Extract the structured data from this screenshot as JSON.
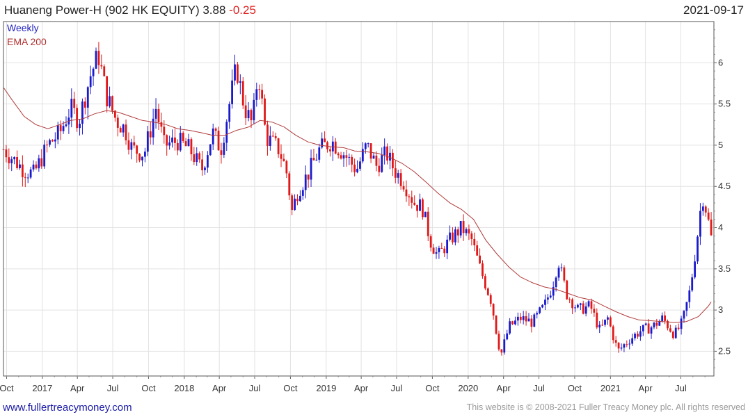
{
  "header": {
    "title": "Huaneng Power-H (902 HK EQUITY) 3.88",
    "change": "-0.25",
    "date": "2021-09-17"
  },
  "legend": {
    "weekly": "Weekly",
    "ema": "EMA 200"
  },
  "footer": {
    "site": "www.fullertreacymoney.com",
    "copyright": "This website is © 2008-2021 Fuller Treacy Money plc. All rights reserved"
  },
  "colors": {
    "up": "#1a1acc",
    "down": "#e01818",
    "ema": "#b03a3a",
    "grid": "#e2e2e2",
    "border": "#555555"
  },
  "chart_data": {
    "type": "candlestick",
    "frequency": "Weekly",
    "ylim": [
      2.2,
      6.5
    ],
    "yticks": [
      2.5,
      3,
      3.5,
      4,
      4.5,
      5,
      5.5,
      6
    ],
    "ytick_labels": [
      "2.5",
      "3",
      "3.5",
      "4",
      "4.5",
      "5",
      "5.5",
      "6"
    ],
    "xlim": [
      "2016-09-23",
      "2021-09-24"
    ],
    "xticks": [
      {
        "date": "2016-10-01",
        "label": "Oct"
      },
      {
        "date": "2017-01-01",
        "label": "2017"
      },
      {
        "date": "2017-04-01",
        "label": "Apr"
      },
      {
        "date": "2017-07-01",
        "label": "Jul"
      },
      {
        "date": "2017-10-01",
        "label": "Oct"
      },
      {
        "date": "2018-01-01",
        "label": "2018"
      },
      {
        "date": "2018-04-01",
        "label": "Apr"
      },
      {
        "date": "2018-07-01",
        "label": "Jul"
      },
      {
        "date": "2018-10-01",
        "label": "Oct"
      },
      {
        "date": "2019-01-01",
        "label": "2019"
      },
      {
        "date": "2019-04-01",
        "label": "Apr"
      },
      {
        "date": "2019-07-01",
        "label": "Jul"
      },
      {
        "date": "2019-10-01",
        "label": "Oct"
      },
      {
        "date": "2020-01-01",
        "label": "2020"
      },
      {
        "date": "2020-04-01",
        "label": "Apr"
      },
      {
        "date": "2020-07-01",
        "label": "Jul"
      },
      {
        "date": "2020-10-01",
        "label": "Oct"
      },
      {
        "date": "2021-01-01",
        "label": "2021"
      },
      {
        "date": "2021-04-01",
        "label": "Apr"
      },
      {
        "date": "2021-07-01",
        "label": "Jul"
      }
    ],
    "close_path": [
      [
        "2016-09-23",
        4.95
      ],
      [
        "2016-11-15",
        4.7
      ],
      [
        "2016-12-10",
        4.65
      ],
      [
        "2017-01-15",
        5.0
      ],
      [
        "2017-02-15",
        5.15
      ],
      [
        "2017-03-15",
        5.45
      ],
      [
        "2017-04-05",
        5.3
      ],
      [
        "2017-05-05",
        5.85
      ],
      [
        "2017-05-25",
        6.1
      ],
      [
        "2017-06-15",
        5.6
      ],
      [
        "2017-07-10",
        5.3
      ],
      [
        "2017-08-01",
        5.2
      ],
      [
        "2017-08-20",
        4.95
      ],
      [
        "2017-09-20",
        4.9
      ],
      [
        "2017-10-20",
        5.45
      ],
      [
        "2017-11-10",
        5.0
      ],
      [
        "2017-12-15",
        5.05
      ],
      [
        "2018-01-15",
        4.95
      ],
      [
        "2018-02-15",
        4.7
      ],
      [
        "2018-03-15",
        5.15
      ],
      [
        "2018-04-05",
        4.95
      ],
      [
        "2018-05-01",
        5.6
      ],
      [
        "2018-05-15",
        5.95
      ],
      [
        "2018-06-05",
        5.45
      ],
      [
        "2018-06-25",
        5.25
      ],
      [
        "2018-07-10",
        5.9
      ],
      [
        "2018-07-30",
        5.1
      ],
      [
        "2018-09-01",
        4.95
      ],
      [
        "2018-09-20",
        4.7
      ],
      [
        "2018-10-05",
        4.2
      ],
      [
        "2018-10-20",
        4.45
      ],
      [
        "2018-11-15",
        4.65
      ],
      [
        "2018-12-15",
        4.95
      ],
      [
        "2019-01-15",
        5.05
      ],
      [
        "2019-02-15",
        4.9
      ],
      [
        "2019-03-20",
        4.7
      ],
      [
        "2019-04-15",
        5.0
      ],
      [
        "2019-05-10",
        4.75
      ],
      [
        "2019-06-05",
        4.9
      ],
      [
        "2019-06-25",
        4.7
      ],
      [
        "2019-07-20",
        4.55
      ],
      [
        "2019-08-15",
        4.3
      ],
      [
        "2019-09-05",
        4.25
      ],
      [
        "2019-09-25",
        3.85
      ],
      [
        "2019-10-15",
        3.65
      ],
      [
        "2019-11-15",
        3.85
      ],
      [
        "2019-12-15",
        4.0
      ],
      [
        "2020-01-10",
        3.85
      ],
      [
        "2020-02-01",
        3.5
      ],
      [
        "2020-03-01",
        3.1
      ],
      [
        "2020-03-15",
        2.7
      ],
      [
        "2020-03-25",
        2.45
      ],
      [
        "2020-04-15",
        2.8
      ],
      [
        "2020-05-15",
        2.9
      ],
      [
        "2020-06-15",
        2.85
      ],
      [
        "2020-07-15",
        3.05
      ],
      [
        "2020-08-05",
        3.3
      ],
      [
        "2020-08-20",
        3.6
      ],
      [
        "2020-09-10",
        3.2
      ],
      [
        "2020-10-10",
        3.0
      ],
      [
        "2020-11-10",
        3.05
      ],
      [
        "2020-12-05",
        2.75
      ],
      [
        "2020-12-25",
        2.9
      ],
      [
        "2021-01-20",
        2.5
      ],
      [
        "2021-02-20",
        2.65
      ],
      [
        "2021-03-20",
        2.75
      ],
      [
        "2021-04-20",
        2.8
      ],
      [
        "2021-05-15",
        2.9
      ],
      [
        "2021-06-15",
        2.7
      ],
      [
        "2021-07-05",
        2.85
      ],
      [
        "2021-07-25",
        3.25
      ],
      [
        "2021-08-10",
        3.8
      ],
      [
        "2021-08-25",
        4.4
      ],
      [
        "2021-09-05",
        4.2
      ],
      [
        "2021-09-17",
        3.88
      ]
    ],
    "ema200": [
      [
        "2016-09-23",
        5.7
      ],
      [
        "2016-10-15",
        5.55
      ],
      [
        "2016-11-15",
        5.35
      ],
      [
        "2016-12-15",
        5.25
      ],
      [
        "2017-01-15",
        5.2
      ],
      [
        "2017-02-15",
        5.25
      ],
      [
        "2017-03-15",
        5.3
      ],
      [
        "2017-04-15",
        5.32
      ],
      [
        "2017-05-15",
        5.38
      ],
      [
        "2017-06-15",
        5.42
      ],
      [
        "2017-07-15",
        5.4
      ],
      [
        "2017-08-15",
        5.35
      ],
      [
        "2017-09-15",
        5.3
      ],
      [
        "2017-10-15",
        5.28
      ],
      [
        "2017-11-15",
        5.25
      ],
      [
        "2017-12-15",
        5.2
      ],
      [
        "2018-01-15",
        5.18
      ],
      [
        "2018-02-15",
        5.15
      ],
      [
        "2018-03-15",
        5.12
      ],
      [
        "2018-04-15",
        5.12
      ],
      [
        "2018-05-15",
        5.18
      ],
      [
        "2018-06-15",
        5.22
      ],
      [
        "2018-07-15",
        5.3
      ],
      [
        "2018-08-15",
        5.28
      ],
      [
        "2018-09-15",
        5.22
      ],
      [
        "2018-10-15",
        5.12
      ],
      [
        "2018-11-15",
        5.04
      ],
      [
        "2018-12-15",
        5.0
      ],
      [
        "2019-01-15",
        4.98
      ],
      [
        "2019-02-15",
        4.97
      ],
      [
        "2019-03-15",
        4.93
      ],
      [
        "2019-04-15",
        4.92
      ],
      [
        "2019-05-15",
        4.9
      ],
      [
        "2019-06-15",
        4.85
      ],
      [
        "2019-07-15",
        4.78
      ],
      [
        "2019-08-15",
        4.68
      ],
      [
        "2019-09-15",
        4.55
      ],
      [
        "2019-10-15",
        4.42
      ],
      [
        "2019-11-15",
        4.3
      ],
      [
        "2019-12-15",
        4.22
      ],
      [
        "2020-01-15",
        4.1
      ],
      [
        "2020-02-15",
        3.85
      ],
      [
        "2020-03-15",
        3.68
      ],
      [
        "2020-04-15",
        3.52
      ],
      [
        "2020-05-15",
        3.4
      ],
      [
        "2020-06-15",
        3.33
      ],
      [
        "2020-07-15",
        3.28
      ],
      [
        "2020-08-15",
        3.25
      ],
      [
        "2020-09-15",
        3.2
      ],
      [
        "2020-10-15",
        3.15
      ],
      [
        "2020-11-15",
        3.12
      ],
      [
        "2020-12-15",
        3.05
      ],
      [
        "2021-01-15",
        2.98
      ],
      [
        "2021-02-15",
        2.92
      ],
      [
        "2021-03-15",
        2.88
      ],
      [
        "2021-04-15",
        2.87
      ],
      [
        "2021-05-15",
        2.86
      ],
      [
        "2021-06-15",
        2.85
      ],
      [
        "2021-07-15",
        2.86
      ],
      [
        "2021-08-15",
        2.92
      ],
      [
        "2021-09-10",
        3.05
      ],
      [
        "2021-09-17",
        3.1
      ]
    ]
  }
}
